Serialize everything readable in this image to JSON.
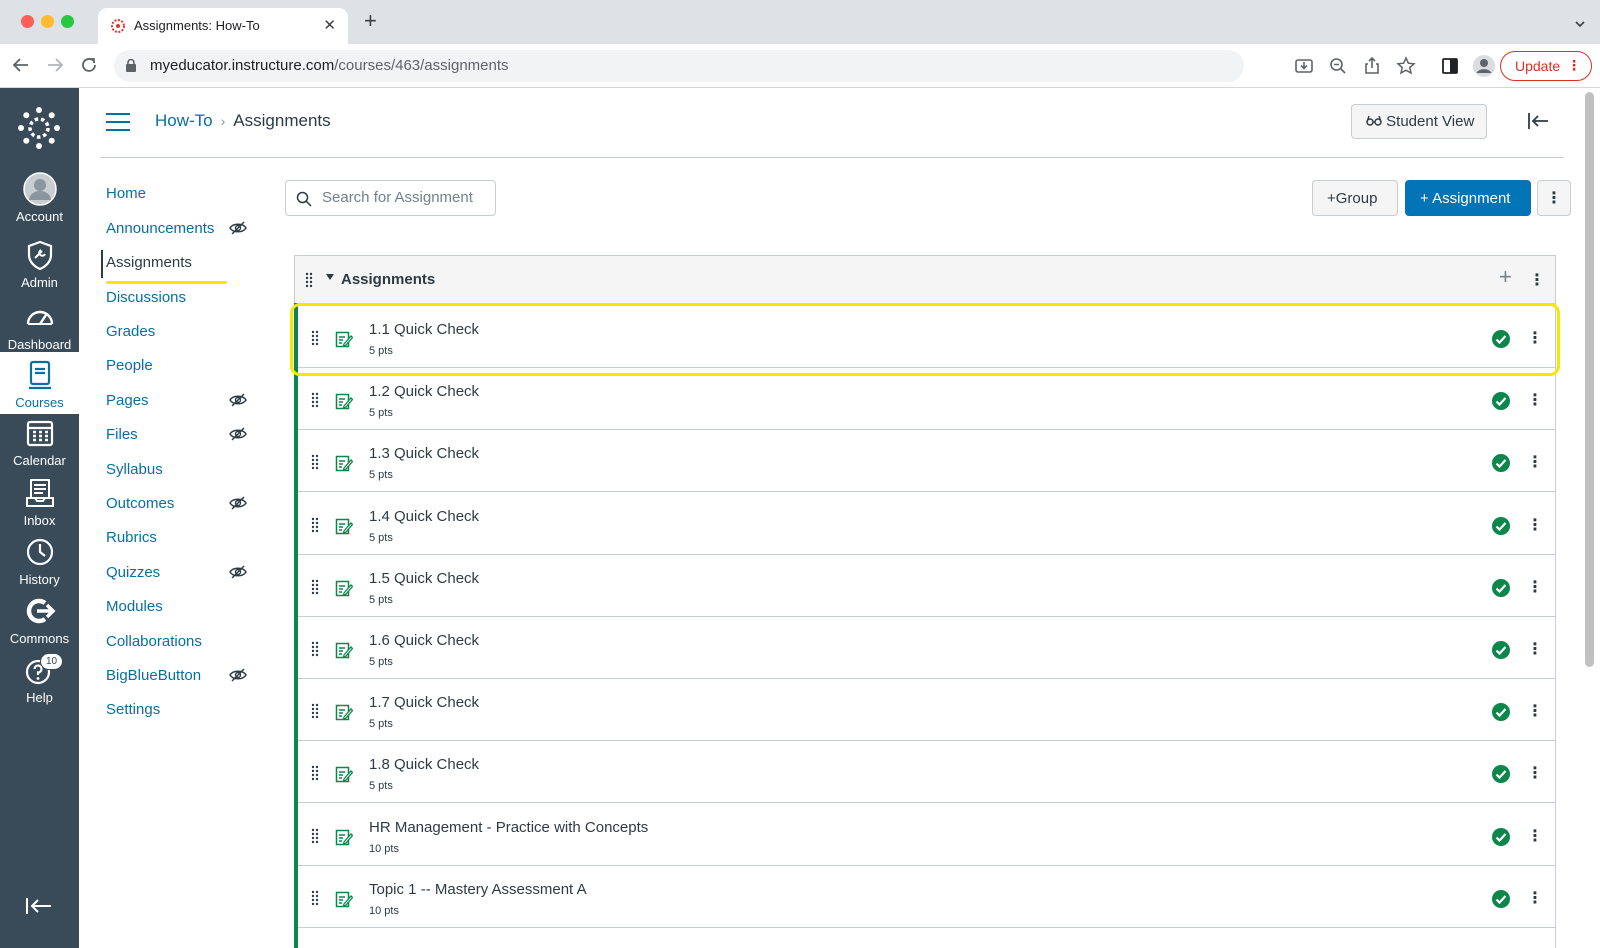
{
  "browser": {
    "tab_title": "Assignments: How-To",
    "new_tab": "+",
    "close": "✕",
    "url_host": "myeducator.instructure.com",
    "url_path": "/courses/463/assignments",
    "update_label": "Update"
  },
  "global_nav": {
    "items": [
      {
        "label": "Account",
        "icon": "account-icon"
      },
      {
        "label": "Admin",
        "icon": "admin-icon"
      },
      {
        "label": "Dashboard",
        "icon": "dashboard-icon"
      },
      {
        "label": "Courses",
        "icon": "courses-icon",
        "active": true
      },
      {
        "label": "Calendar",
        "icon": "calendar-icon"
      },
      {
        "label": "Inbox",
        "icon": "inbox-icon"
      },
      {
        "label": "History",
        "icon": "history-icon"
      },
      {
        "label": "Commons",
        "icon": "commons-icon"
      },
      {
        "label": "Help",
        "icon": "help-icon",
        "badge": "10"
      }
    ]
  },
  "header": {
    "breadcrumb_course": "How-To",
    "breadcrumb_separator": "›",
    "breadcrumb_page": "Assignments",
    "student_view_label": "Student View"
  },
  "course_nav": {
    "items": [
      {
        "label": "Home",
        "hidden": false
      },
      {
        "label": "Announcements",
        "hidden": true
      },
      {
        "label": "Assignments",
        "hidden": false,
        "active": true
      },
      {
        "label": "Discussions",
        "hidden": false
      },
      {
        "label": "Grades",
        "hidden": false
      },
      {
        "label": "People",
        "hidden": false
      },
      {
        "label": "Pages",
        "hidden": true
      },
      {
        "label": "Files",
        "hidden": true
      },
      {
        "label": "Syllabus",
        "hidden": false
      },
      {
        "label": "Outcomes",
        "hidden": true
      },
      {
        "label": "Rubrics",
        "hidden": false
      },
      {
        "label": "Quizzes",
        "hidden": true
      },
      {
        "label": "Modules",
        "hidden": false
      },
      {
        "label": "Collaborations",
        "hidden": false
      },
      {
        "label": "BigBlueButton",
        "hidden": true
      },
      {
        "label": "Settings",
        "hidden": false
      }
    ]
  },
  "toolbar": {
    "search_placeholder": "Search for Assignment",
    "group_label": "+Group",
    "assignment_label": "+ Assignment"
  },
  "group": {
    "title": "Assignments",
    "add": "+",
    "assignments": [
      {
        "title": "1.1 Quick Check",
        "points": "5 pts",
        "published": true
      },
      {
        "title": "1.2 Quick Check",
        "points": "5 pts",
        "published": true
      },
      {
        "title": "1.3 Quick Check",
        "points": "5 pts",
        "published": true
      },
      {
        "title": "1.4 Quick Check",
        "points": "5 pts",
        "published": true
      },
      {
        "title": "1.5 Quick Check",
        "points": "5 pts",
        "published": true
      },
      {
        "title": "1.6 Quick Check",
        "points": "5 pts",
        "published": true
      },
      {
        "title": "1.7 Quick Check",
        "points": "5 pts",
        "published": true
      },
      {
        "title": "1.8 Quick Check",
        "points": "5 pts",
        "published": true
      },
      {
        "title": "HR Management - Practice with Concepts",
        "points": "10 pts",
        "published": true
      },
      {
        "title": "Topic 1 -- Mastery Assessment A",
        "points": "10 pts",
        "published": true
      }
    ]
  },
  "colors": {
    "nav_bg": "#394b58",
    "link": "#0770a3",
    "primary_button": "#0374b5",
    "published_green": "#0b874b",
    "highlight": "#f5e900"
  }
}
